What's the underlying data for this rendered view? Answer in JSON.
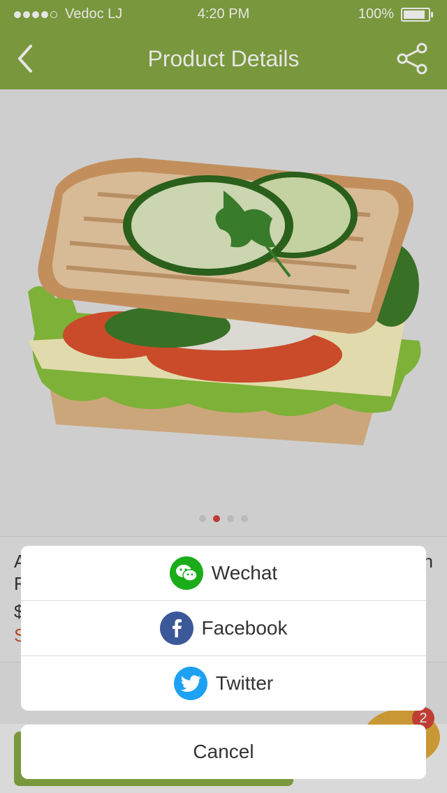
{
  "status_bar": {
    "carrier": "Vedoc LJ",
    "time": "4:20 PM",
    "battery": "100%",
    "signal_dots_filled": 4,
    "battery_level": 1.0
  },
  "header": {
    "title": "Product Details",
    "back_icon": "back-chevron-icon",
    "share_icon": "share-icon"
  },
  "carousel": {
    "pages": 4,
    "active_index": 1
  },
  "product_peek": {
    "line1_left": "A",
    "line1_right": "n",
    "line2": "F",
    "line3": "$",
    "line4": "S"
  },
  "cart": {
    "badge_count": "2"
  },
  "share_sheet": {
    "options": [
      {
        "label": "Wechat",
        "icon": "wechat-icon",
        "color": "#1aad19"
      },
      {
        "label": "Facebook",
        "icon": "facebook-icon",
        "color": "#3b5998"
      },
      {
        "label": "Twitter",
        "icon": "twitter-icon",
        "color": "#1da1f2"
      }
    ],
    "cancel_label": "Cancel"
  },
  "colors": {
    "brand_green": "#87a943",
    "accent_red": "#d5413b"
  }
}
